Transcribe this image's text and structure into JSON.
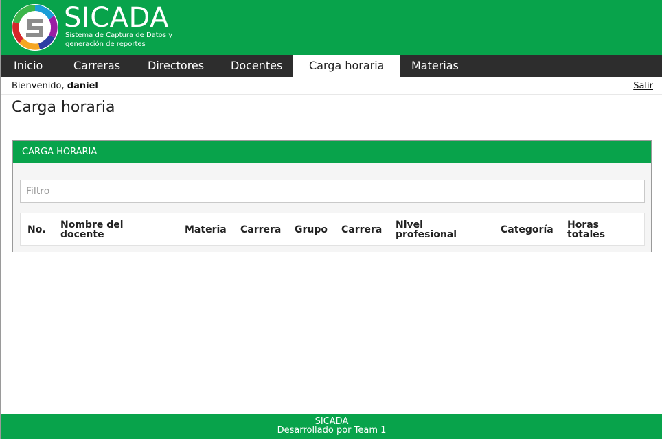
{
  "brand": {
    "title": "SICADA",
    "subtitle_line1": "Sistema de Captura de Datos y",
    "subtitle_line2": "generación de reportes",
    "logo_colors": [
      "#1a9dd8",
      "#9b1ea4",
      "#d6282a",
      "#f5a623",
      "#2c3ea3",
      "#3bb54a"
    ],
    "logo_icon": "sicada-logo-icon"
  },
  "nav": {
    "items": [
      {
        "label": "Inicio",
        "active": false
      },
      {
        "label": "Carreras",
        "active": false
      },
      {
        "label": "Directores",
        "active": false
      },
      {
        "label": "Docentes",
        "active": false
      },
      {
        "label": "Carga horaria",
        "active": true
      },
      {
        "label": "Materias",
        "active": false
      }
    ]
  },
  "user_bar": {
    "greeting": "Bienvenido,",
    "username": "daniel",
    "logout_label": "Salir"
  },
  "page": {
    "title": "Carga horaria"
  },
  "panel": {
    "heading": "CARGA HORARIA",
    "filter_placeholder": "Filtro",
    "filter_value": "",
    "columns": [
      {
        "line1": "No.",
        "line2": ""
      },
      {
        "line1": "Nombre del",
        "line2": "docente"
      },
      {
        "line1": "Materia",
        "line2": ""
      },
      {
        "line1": "Carrera",
        "line2": ""
      },
      {
        "line1": "Grupo",
        "line2": ""
      },
      {
        "line1": "Carrera",
        "line2": ""
      },
      {
        "line1": "Nivel",
        "line2": "profesional"
      },
      {
        "line1": "Categoría",
        "line2": ""
      },
      {
        "line1": "Horas",
        "line2": "totales"
      }
    ],
    "rows": []
  },
  "footer": {
    "line1": "SICADA",
    "line2": "Desarrollado por Team 1"
  },
  "colors": {
    "brand_green": "#08a34b",
    "nav_dark": "#2d2d2d"
  }
}
